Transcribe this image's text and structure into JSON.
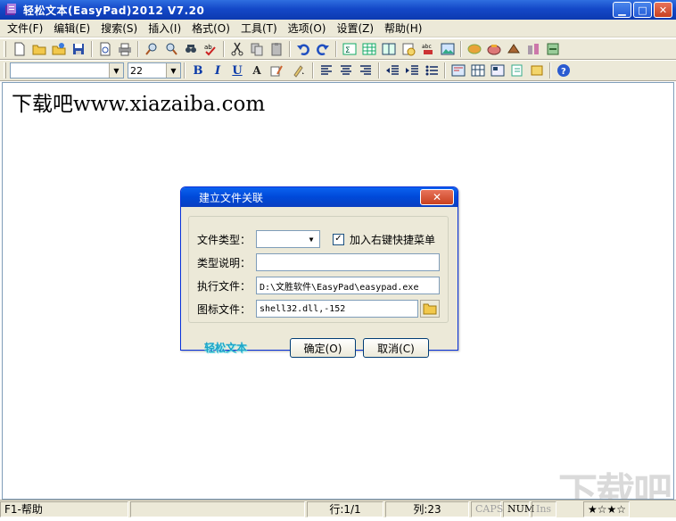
{
  "window": {
    "title": "轻松文本(EasyPad)2012  V7.20",
    "controls": {
      "minimize": "▁",
      "maximize": "□",
      "close": "✕"
    }
  },
  "menu": [
    "文件(F)",
    "编辑(E)",
    "搜索(S)",
    "插入(I)",
    "格式(O)",
    "工具(T)",
    "选项(O)",
    "设置(Z)",
    "帮助(H)"
  ],
  "toolbar1_icons": [
    "new-file-icon",
    "open-folder-icon",
    "open-recent-icon",
    "save-icon",
    "print-preview-icon",
    "print-icon",
    "find-icon",
    "find-next-icon",
    "replace-icon",
    "spell-check-icon",
    "cut-icon",
    "copy-icon",
    "paste-icon",
    "undo-icon",
    "redo-icon",
    "insert-char-icon",
    "insert-table-icon",
    "insert-book-icon",
    "insert-date-icon",
    "insert-abc-icon",
    "insert-image-icon",
    "tool-1-icon",
    "tool-2-icon",
    "tool-3-icon",
    "tool-4-icon",
    "tool-5-icon"
  ],
  "toolbar2": {
    "font_value": "",
    "size_value": "22",
    "bold": "B",
    "italic": "I",
    "underline": "U",
    "font_color": "A"
  },
  "editor": {
    "content": "下载吧www.xiazaiba.com"
  },
  "dialog": {
    "title": "建立文件关联",
    "close": "✕",
    "file_type_label": "文件类型：",
    "file_type_value": "",
    "context_menu_checkbox": "加入右键快捷菜单",
    "context_menu_checked": true,
    "type_desc_label": "类型说明：",
    "type_desc_value": "",
    "exec_file_label": "执行文件：",
    "exec_file_value": "D:\\文胜软件\\EasyPad\\easypad.exe",
    "icon_file_label": "图标文件：",
    "icon_file_value": "shell32.dll,-152",
    "brand": "轻松文本",
    "ok_button": "确定(O)",
    "cancel_button": "取消(C)"
  },
  "status": {
    "help": "F1-帮助",
    "line": "行:1/1",
    "col": "列:23",
    "caps": "CAPS",
    "num": "NUM",
    "ins": "Ins",
    "rating": "★☆★☆"
  },
  "watermark": "下载吧"
}
